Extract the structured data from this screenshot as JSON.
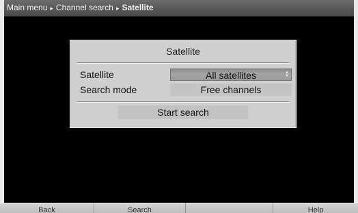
{
  "breadcrumb": {
    "items": [
      "Main menu",
      "Channel search",
      "Satellite"
    ],
    "separator": "▸"
  },
  "dialog": {
    "title": "Satellite",
    "rows": [
      {
        "label": "Satellite",
        "value": "All satellites",
        "state": "selected"
      },
      {
        "label": "Search mode",
        "value": "Free channels",
        "state": "normal"
      }
    ],
    "action": "Start search"
  },
  "function_keys": [
    {
      "label": "Back",
      "color": "red"
    },
    {
      "label": "Search",
      "color": "green"
    },
    {
      "label": "",
      "color": "yellow"
    },
    {
      "label": "Help",
      "color": "blue"
    }
  ],
  "colors": {
    "background": "#000000",
    "dialog": "#cfcfcf",
    "selected_field": "#9a9a9a",
    "header": "#555555"
  }
}
